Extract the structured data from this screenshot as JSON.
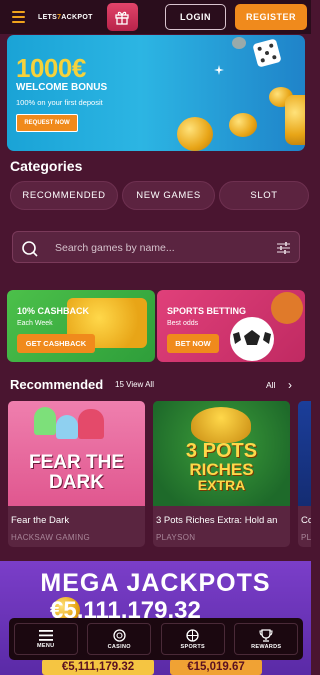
{
  "header": {
    "logo_text": "LETS",
    "logo_seven": "7",
    "logo_text2": "ACKPOT",
    "login_label": "LOGIN",
    "register_label": "REGISTER"
  },
  "banner": {
    "amount": "1000€",
    "title": "WELCOME BONUS",
    "subtitle": "100% on your first deposit",
    "button": "REQUEST NOW"
  },
  "categories": {
    "title": "Categories",
    "items": [
      "RECOMMENDED",
      "NEW GAMES",
      "SLOT"
    ]
  },
  "search": {
    "placeholder": "Search games by name..."
  },
  "promos": [
    {
      "title": "10% CASHBACK",
      "subtitle": "Each Week",
      "button": "GET CASHBACK"
    },
    {
      "title": "SPORTS BETTING",
      "subtitle": "Best odds",
      "button": "BET NOW"
    }
  ],
  "recommended": {
    "title": "Recommended",
    "count": "15 View All",
    "all": "All",
    "arrow": "›",
    "games": [
      {
        "name": "Fear the Dark",
        "provider": "HACKSAW GAMING",
        "art_line1": "FEAR THE",
        "art_line2": "DARK"
      },
      {
        "name": "3 Pots Riches Extra: Hold an",
        "provider": "PLAYSON",
        "art_line1": "3 POTS",
        "art_line2": "RICHES",
        "art_line3": "EXTRA"
      },
      {
        "name": "Co",
        "provider": "PL"
      }
    ]
  },
  "mega": {
    "title": "MEGA JACKPOTS",
    "big_amount": "€5,111,179.32",
    "jackpots": [
      "€5,111,179.32",
      "€15,019.67"
    ]
  },
  "bottom_nav": [
    {
      "label": "MENU",
      "icon": "menu-icon"
    },
    {
      "label": "CASINO",
      "icon": "casino-chip-icon"
    },
    {
      "label": "SPORTS",
      "icon": "basketball-icon"
    },
    {
      "label": "REWARDS",
      "icon": "trophy-icon"
    }
  ],
  "colors": {
    "background": "#4a1530",
    "header": "#2a0d1c",
    "accent": "#f08a1c",
    "banner": "#2cb5e3",
    "promo_green": "#4cc04a",
    "promo_pink": "#e0407a",
    "mega": "#7b3ec9",
    "jackpot_gold": "#f5c542",
    "jackpot_orange": "#f0a234"
  }
}
